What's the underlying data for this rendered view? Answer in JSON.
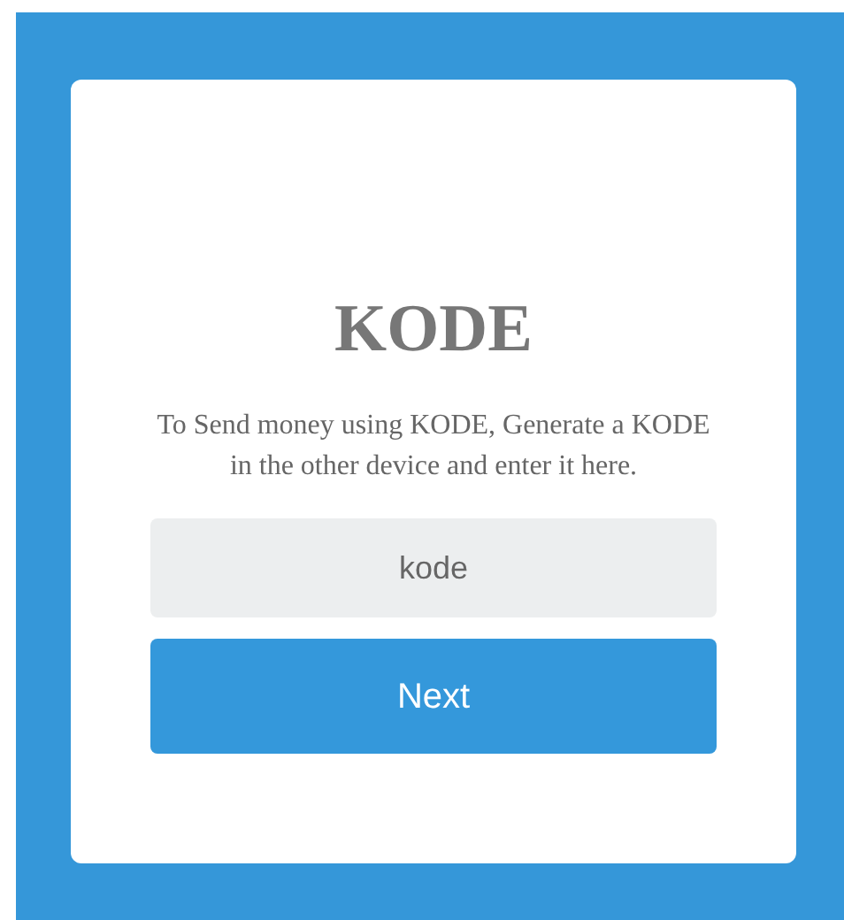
{
  "title": "KODE",
  "instructions": "To Send money using KODE, Generate a KODE in the other device and enter it here.",
  "kode_field": {
    "placeholder": "kode"
  },
  "next_button": {
    "label": "Next"
  }
}
